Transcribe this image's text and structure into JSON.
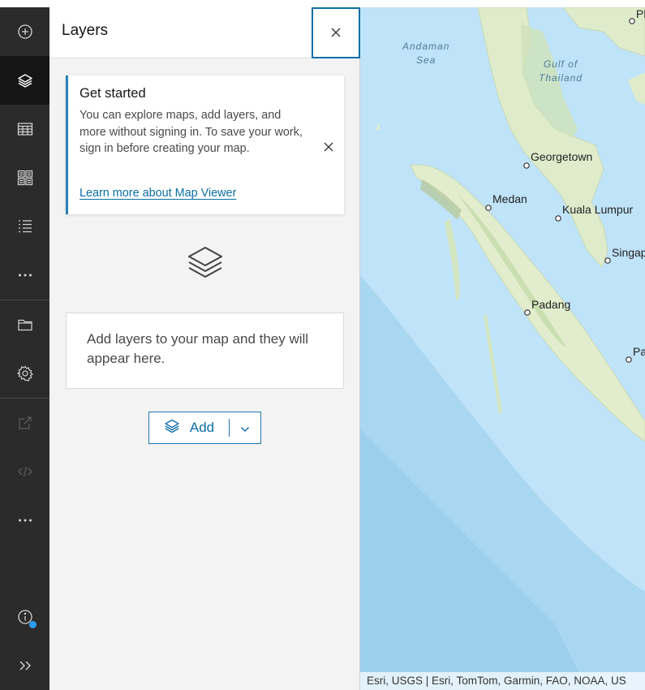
{
  "rail": {
    "items": [
      {
        "name": "add-content",
        "icon": "plus-circle-icon"
      },
      {
        "name": "layers",
        "icon": "layers-icon",
        "active": true
      },
      {
        "name": "tables",
        "icon": "table-icon"
      },
      {
        "name": "basemap",
        "icon": "basemap-gallery-icon"
      },
      {
        "name": "legend",
        "icon": "legend-list-icon"
      },
      {
        "name": "more-1",
        "icon": "more-horizontal-icon"
      },
      {
        "name": "map-properties",
        "icon": "folder-icon"
      },
      {
        "name": "settings",
        "icon": "gear-icon"
      },
      {
        "name": "share",
        "icon": "share-icon",
        "disabled": true
      },
      {
        "name": "embed",
        "icon": "code-icon",
        "disabled": true
      },
      {
        "name": "more-2",
        "icon": "more-horizontal-icon"
      },
      {
        "name": "info",
        "icon": "info-icon"
      },
      {
        "name": "expand",
        "icon": "double-chevron-right-icon"
      }
    ],
    "colors": {
      "background": "#2b2b2b",
      "active": "#151515",
      "notify_dot": "#2b9cf5"
    }
  },
  "panel": {
    "title": "Layers",
    "notice": {
      "title": "Get started",
      "body": "You can explore maps, add layers, and more without signing in. To save your work, sign in before creating your map.",
      "link": "Learn more about Map Viewer"
    },
    "empty_message": "Add layers to your map and they will appear here.",
    "add_button_label": "Add",
    "colors": {
      "accent": "#0e6ea5"
    }
  },
  "map": {
    "places": {
      "georgetown": "Georgetown",
      "medan": "Medan",
      "kuala_lumpur": "Kuala Lumpur",
      "singapore": "Singap",
      "padang": "Padang",
      "pa": "Pa",
      "ph": "Ph"
    },
    "water": {
      "andaman_1": "Andaman",
      "andaman_2": "Sea",
      "thailand_1": "Gulf of",
      "thailand_2": "Thailand"
    },
    "attribution": "Esri, USGS | Esri, TomTom, Garmin, FAO, NOAA, US"
  }
}
